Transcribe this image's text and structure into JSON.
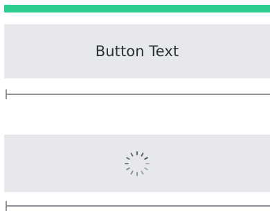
{
  "progress": {
    "color": "#2ecc8f",
    "level": 1.0
  },
  "primary_button": {
    "label": "Button Text"
  },
  "loading_button": {
    "icon": "loading-spinner-icon"
  },
  "colors": {
    "button_bg": "#e7e8ec",
    "divider": "#8c8f96",
    "text": "#2b2f36"
  }
}
